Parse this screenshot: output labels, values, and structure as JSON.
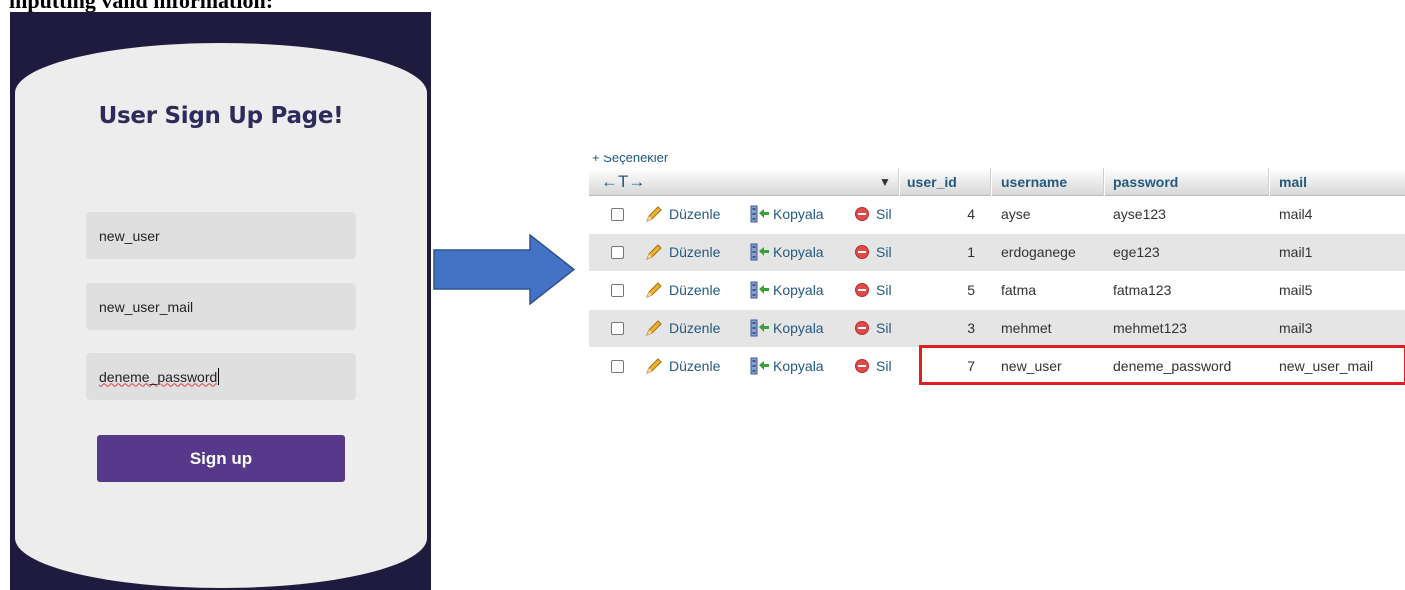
{
  "caption": "inputting valid information:",
  "signup": {
    "title": "User Sign Up Page!",
    "username_value": "new_user",
    "mail_value": "new_user_mail",
    "password_value": "deneme_password",
    "button_label": "Sign up"
  },
  "db_table": {
    "options_label": "+ Seçenekler",
    "column_arrows": "←T→",
    "sort_icon": "sort-down-icon",
    "columns": [
      "user_id",
      "username",
      "password",
      "mail"
    ],
    "action_labels": {
      "edit": "Düzenle",
      "copy": "Kopyala",
      "delete": "Sil"
    },
    "rows": [
      {
        "user_id": "4",
        "username": "ayse",
        "password": "ayse123",
        "mail": "mail4"
      },
      {
        "user_id": "1",
        "username": "erdoganege",
        "password": "ege123",
        "mail": "mail1"
      },
      {
        "user_id": "5",
        "username": "fatma",
        "password": "fatma123",
        "mail": "mail5"
      },
      {
        "user_id": "3",
        "username": "mehmet",
        "password": "mehmet123",
        "mail": "mail3"
      },
      {
        "user_id": "7",
        "username": "new_user",
        "password": "deneme_password",
        "mail": "new_user_mail"
      }
    ],
    "highlight_color": "#e02020"
  },
  "colors": {
    "button": "#56398a",
    "arrow": "#4472c4",
    "link": "#235a81",
    "frame_bg": "#1f1b3f"
  }
}
